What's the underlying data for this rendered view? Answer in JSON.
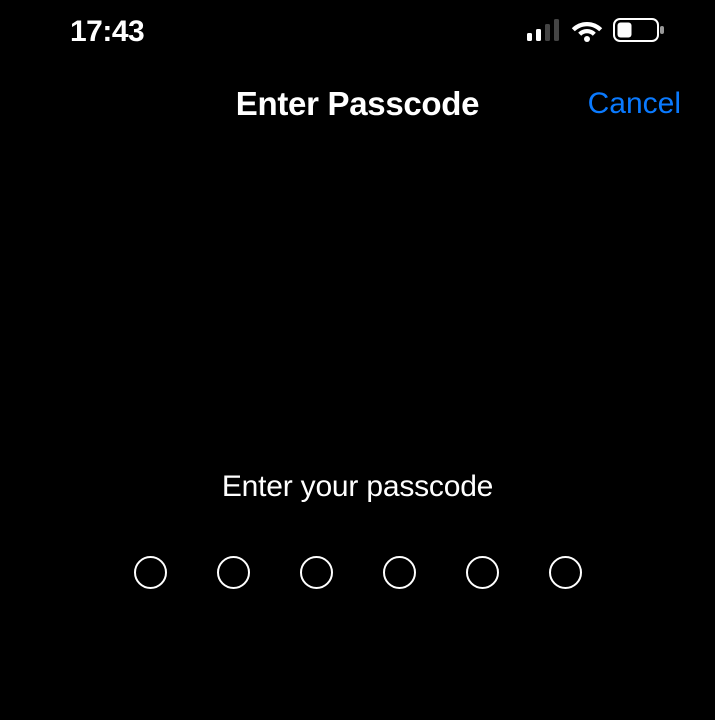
{
  "status": {
    "time": "17:43",
    "cellular_bars_active": 2,
    "cellular_bars_total": 4,
    "wifi_active": true,
    "battery_level": 0.35
  },
  "header": {
    "title": "Enter Passcode",
    "cancel_label": "Cancel"
  },
  "prompt": {
    "text": "Enter your passcode"
  },
  "passcode": {
    "length": 6,
    "filled": 0
  },
  "colors": {
    "accent": "#0a7aff",
    "background": "#000000",
    "foreground": "#ffffff"
  }
}
